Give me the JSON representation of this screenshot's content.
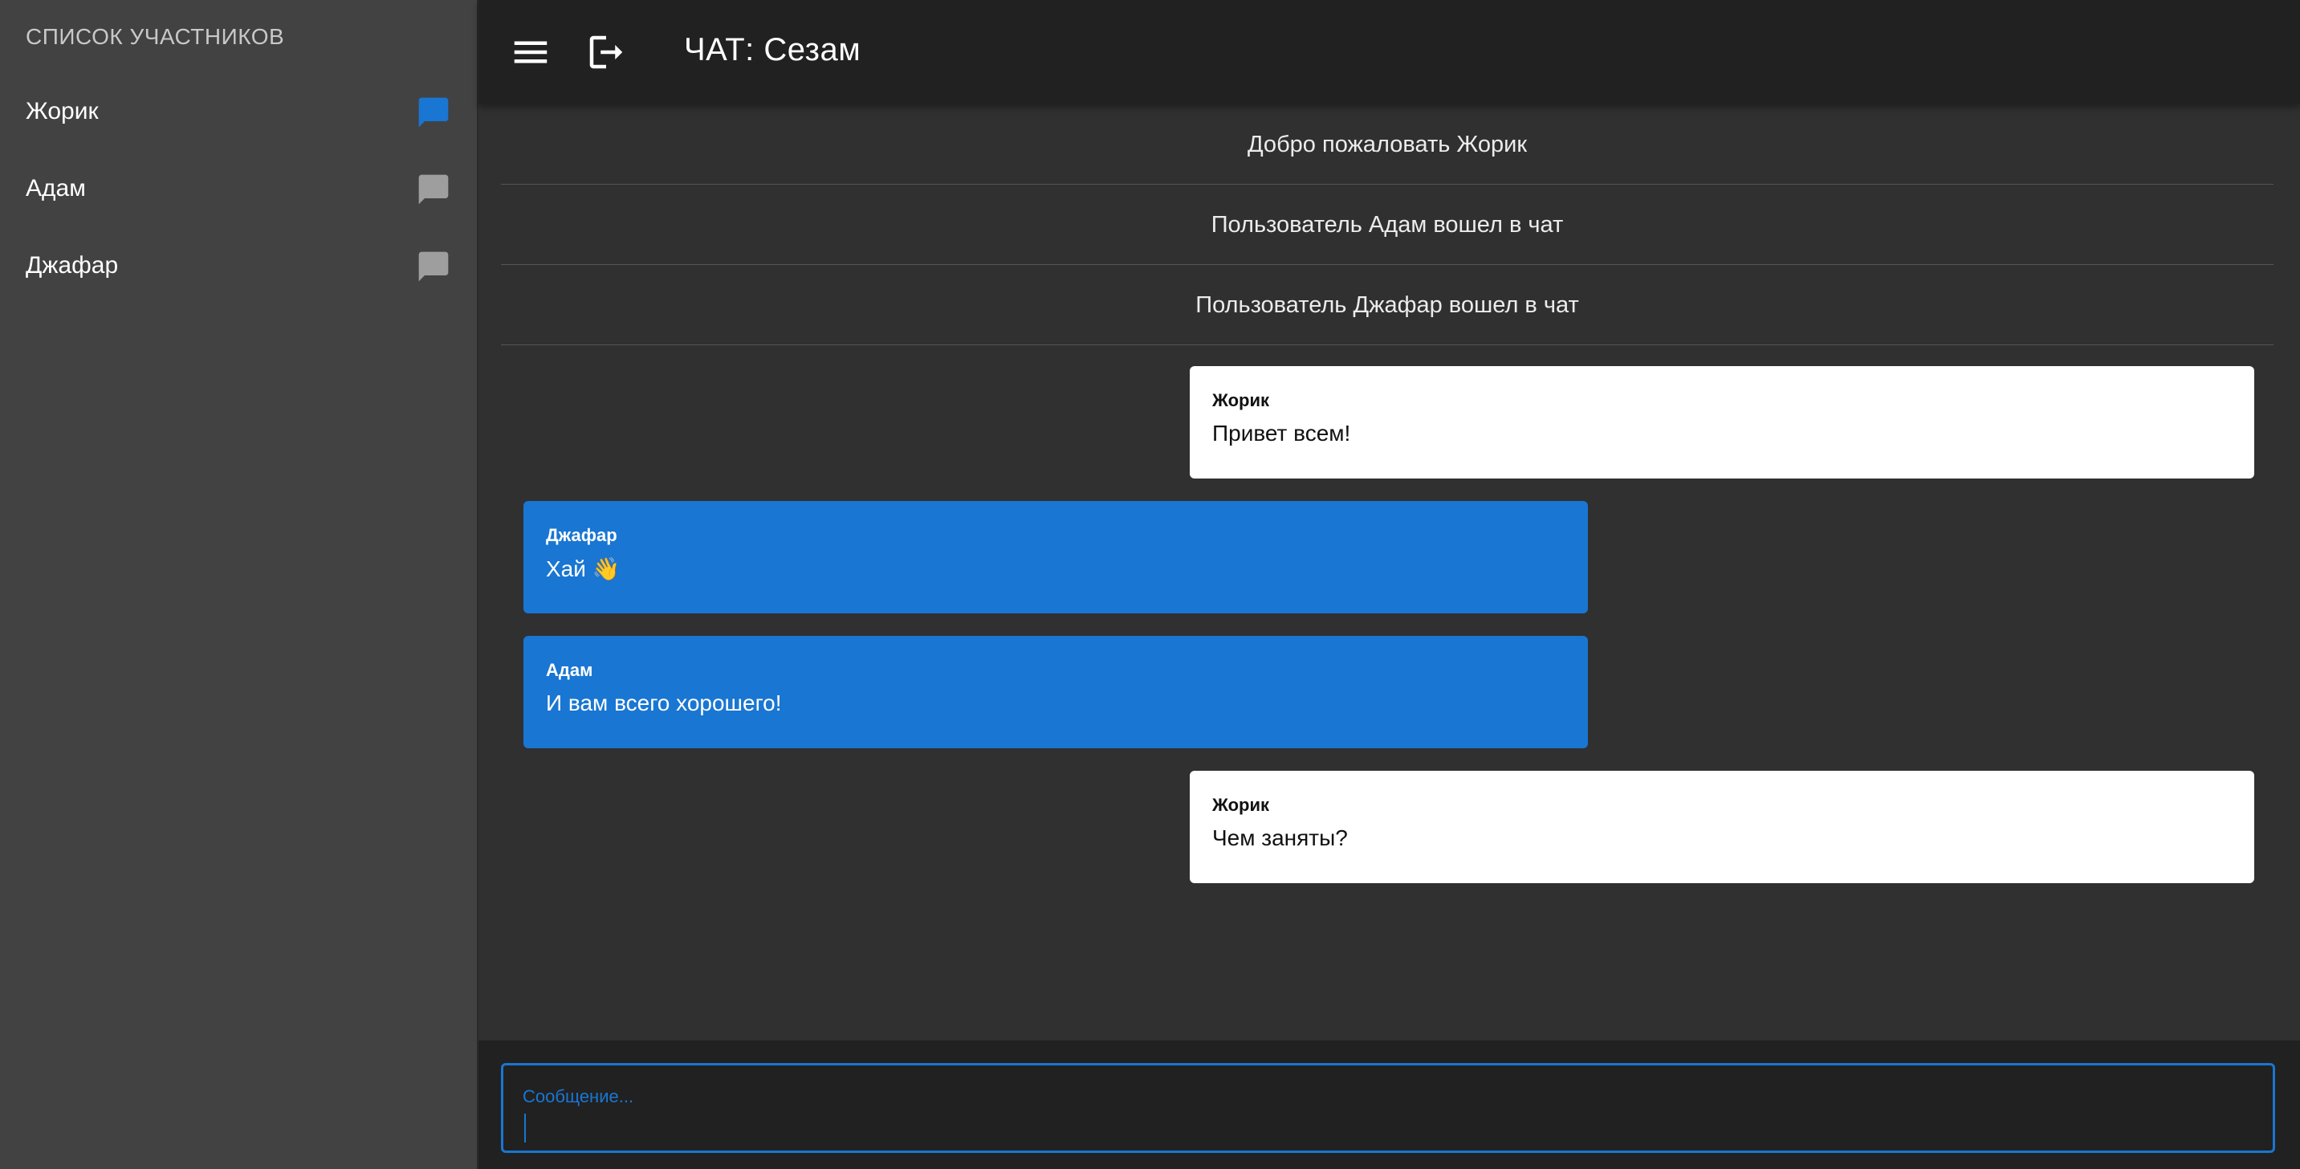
{
  "sidebar": {
    "title": "СПИСОК УЧАСТНИКОВ",
    "members": [
      {
        "name": "Жорик",
        "icon": "chat-bubble-icon",
        "icon_color": "#1976d2"
      },
      {
        "name": "Адам",
        "icon": "chat-bubble-icon",
        "icon_color": "#9e9e9e"
      },
      {
        "name": "Джафар",
        "icon": "chat-bubble-icon",
        "icon_color": "#9e9e9e"
      }
    ]
  },
  "header": {
    "menu_icon": "menu-icon",
    "logout_icon": "logout-icon",
    "title": "ЧАТ: Сезам"
  },
  "system_messages": [
    "Добро пожаловать Жорик",
    "Пользователь Адам вошел в чат",
    "Пользователь Джафар вошел в чат"
  ],
  "messages": [
    {
      "author": "Жорик",
      "text": "Привет всем!",
      "own": true
    },
    {
      "author": "Джафар",
      "text": "Хай 👋",
      "own": false
    },
    {
      "author": "Адам",
      "text": "И вам всего хорошего!",
      "own": false
    },
    {
      "author": "Жорик",
      "text": "Чем заняты?",
      "own": true
    }
  ],
  "composer": {
    "label": "Сообщение...",
    "value": ""
  },
  "colors": {
    "accent": "#1976d2",
    "sidebar_bg": "#424242",
    "header_bg": "#212121",
    "main_bg": "#303030",
    "own_bubble": "#ffffff",
    "other_bubble": "#1976d2"
  }
}
